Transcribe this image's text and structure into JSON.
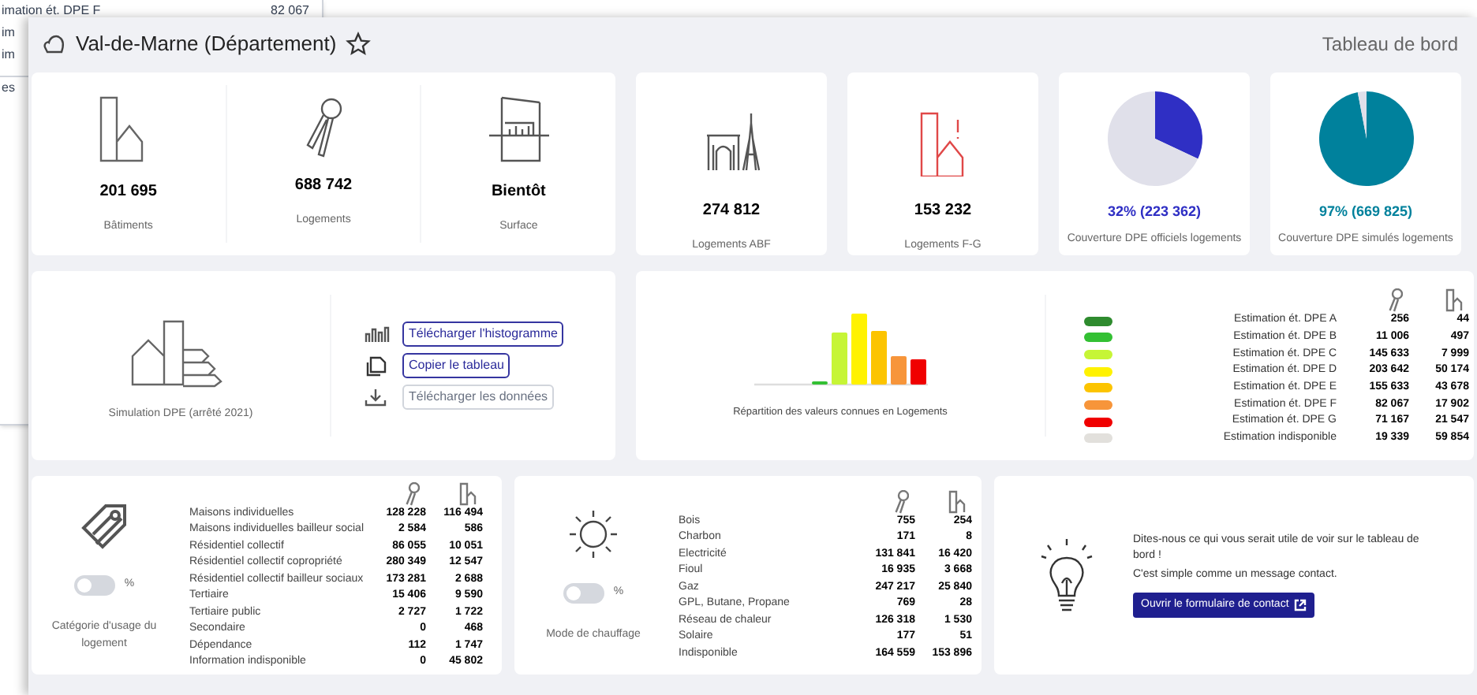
{
  "background_window": {
    "rows": [
      {
        "label": "imation ét. DPE F",
        "value": "82 067"
      },
      {
        "label": "im"
      },
      {
        "label": "im"
      },
      {
        "label": "es"
      }
    ]
  },
  "header": {
    "title": "Val-de-Marne (Département)",
    "favorite": false,
    "right_label": "Tableau de bord"
  },
  "stats": [
    {
      "kind": "buildings",
      "value": "201 695",
      "label": "Bâtiments"
    },
    {
      "kind": "keys",
      "value": "688 742",
      "label": "Logements"
    },
    {
      "kind": "surface",
      "value": "Bientôt",
      "label": "Surface"
    }
  ],
  "cards": [
    {
      "kind": "monument",
      "value": "274 812",
      "label": "Logements ABF"
    },
    {
      "kind": "alert",
      "value": "153 232",
      "label": "Logements F-G"
    },
    {
      "kind": "pie",
      "value": "32% (223 362)",
      "label": "Couverture DPE officiels logements",
      "color": "#2f2fc4",
      "chart_data": {
        "type": "pie",
        "values": [
          32,
          68
        ]
      }
    },
    {
      "kind": "pie",
      "value": "97% (669 825)",
      "label": "Couverture DPE simulés logements",
      "color": "#00819c",
      "chart_data": {
        "type": "pie",
        "values": [
          97,
          3
        ]
      }
    }
  ],
  "simulation": {
    "label": "Simulation DPE (arrêté 2021)",
    "actions": [
      {
        "kind": "histogram",
        "label": "Télécharger l'histogramme",
        "disabled": false
      },
      {
        "kind": "copy",
        "label": "Copier le tableau",
        "disabled": false
      },
      {
        "kind": "download",
        "label": "Télécharger les données",
        "disabled": true
      }
    ]
  },
  "distribution": {
    "caption": "Répartition des valeurs connues en Logements",
    "rows": [
      {
        "label": "Estimation ét. DPE A",
        "color": "#2e8b2e",
        "logements": "256",
        "batiments": "44"
      },
      {
        "label": "Estimation ét. DPE B",
        "color": "#33c033",
        "logements": "11 006",
        "batiments": "497"
      },
      {
        "label": "Estimation ét. DPE C",
        "color": "#c6f536",
        "logements": "145 633",
        "batiments": "7 999"
      },
      {
        "label": "Estimation ét. DPE D",
        "color": "#fff200",
        "logements": "203 642",
        "batiments": "50 174"
      },
      {
        "label": "Estimation ét. DPE E",
        "color": "#fcc400",
        "logements": "155 633",
        "batiments": "43 678"
      },
      {
        "label": "Estimation ét. DPE F",
        "color": "#f7953a",
        "logements": "82 067",
        "batiments": "17 902"
      },
      {
        "label": "Estimation ét. DPE G",
        "color": "#f00000",
        "logements": "71 167",
        "batiments": "21 547"
      },
      {
        "label": "Estimation indisponible",
        "color": "#e2e0dc",
        "logements": "19 339",
        "batiments": "59 854"
      }
    ]
  },
  "breakdowns": [
    {
      "kind": "tag",
      "label": "Catégorie d'usage du logement",
      "toggle": {
        "on": false,
        "label": "%"
      },
      "rows": [
        {
          "label": "Maisons individuelles",
          "logements": "128 228",
          "batiments": "116 494"
        },
        {
          "label": "Maisons individuelles bailleur social",
          "logements": "2 584",
          "batiments": "586"
        },
        {
          "label": "Résidentiel collectif",
          "logements": "86 055",
          "batiments": "10 051"
        },
        {
          "label": "Résidentiel collectif copropriété",
          "logements": "280 349",
          "batiments": "12 547"
        },
        {
          "label": "Résidentiel collectif bailleur sociaux",
          "logements": "173 281",
          "batiments": "2 688"
        },
        {
          "label": "Tertiaire",
          "logements": "15 406",
          "batiments": "9 590"
        },
        {
          "label": "Tertiaire public",
          "logements": "2 727",
          "batiments": "1 722"
        },
        {
          "label": "Secondaire",
          "logements": "0",
          "batiments": "468"
        },
        {
          "label": "Dépendance",
          "logements": "112",
          "batiments": "1 747"
        },
        {
          "label": "Information indisponible",
          "logements": "0",
          "batiments": "45 802"
        }
      ]
    },
    {
      "kind": "sun",
      "label": "Mode de chauffage",
      "toggle": {
        "on": false,
        "label": "%"
      },
      "rows": [
        {
          "label": "Bois",
          "logements": "755",
          "batiments": "254"
        },
        {
          "label": "Charbon",
          "logements": "171",
          "batiments": "8"
        },
        {
          "label": "Electricité",
          "logements": "131 841",
          "batiments": "16 420"
        },
        {
          "label": "Fioul",
          "logements": "16 935",
          "batiments": "3 668"
        },
        {
          "label": "Gaz",
          "logements": "247 217",
          "batiments": "25 840"
        },
        {
          "label": "GPL, Butane, Propane",
          "logements": "769",
          "batiments": "28"
        },
        {
          "label": "Réseau de chaleur",
          "logements": "126 318",
          "batiments": "1 530"
        },
        {
          "label": "Solaire",
          "logements": "177",
          "batiments": "51"
        },
        {
          "label": "Indisponible",
          "logements": "164 559",
          "batiments": "153 896"
        }
      ]
    }
  ],
  "contact": {
    "text": "Dites-nous ce qui vous serait utile de voir sur le tableau de bord !",
    "subtext": "C'est simple comme un message contact.",
    "button": "Ouvrir le formulaire de contact"
  }
}
